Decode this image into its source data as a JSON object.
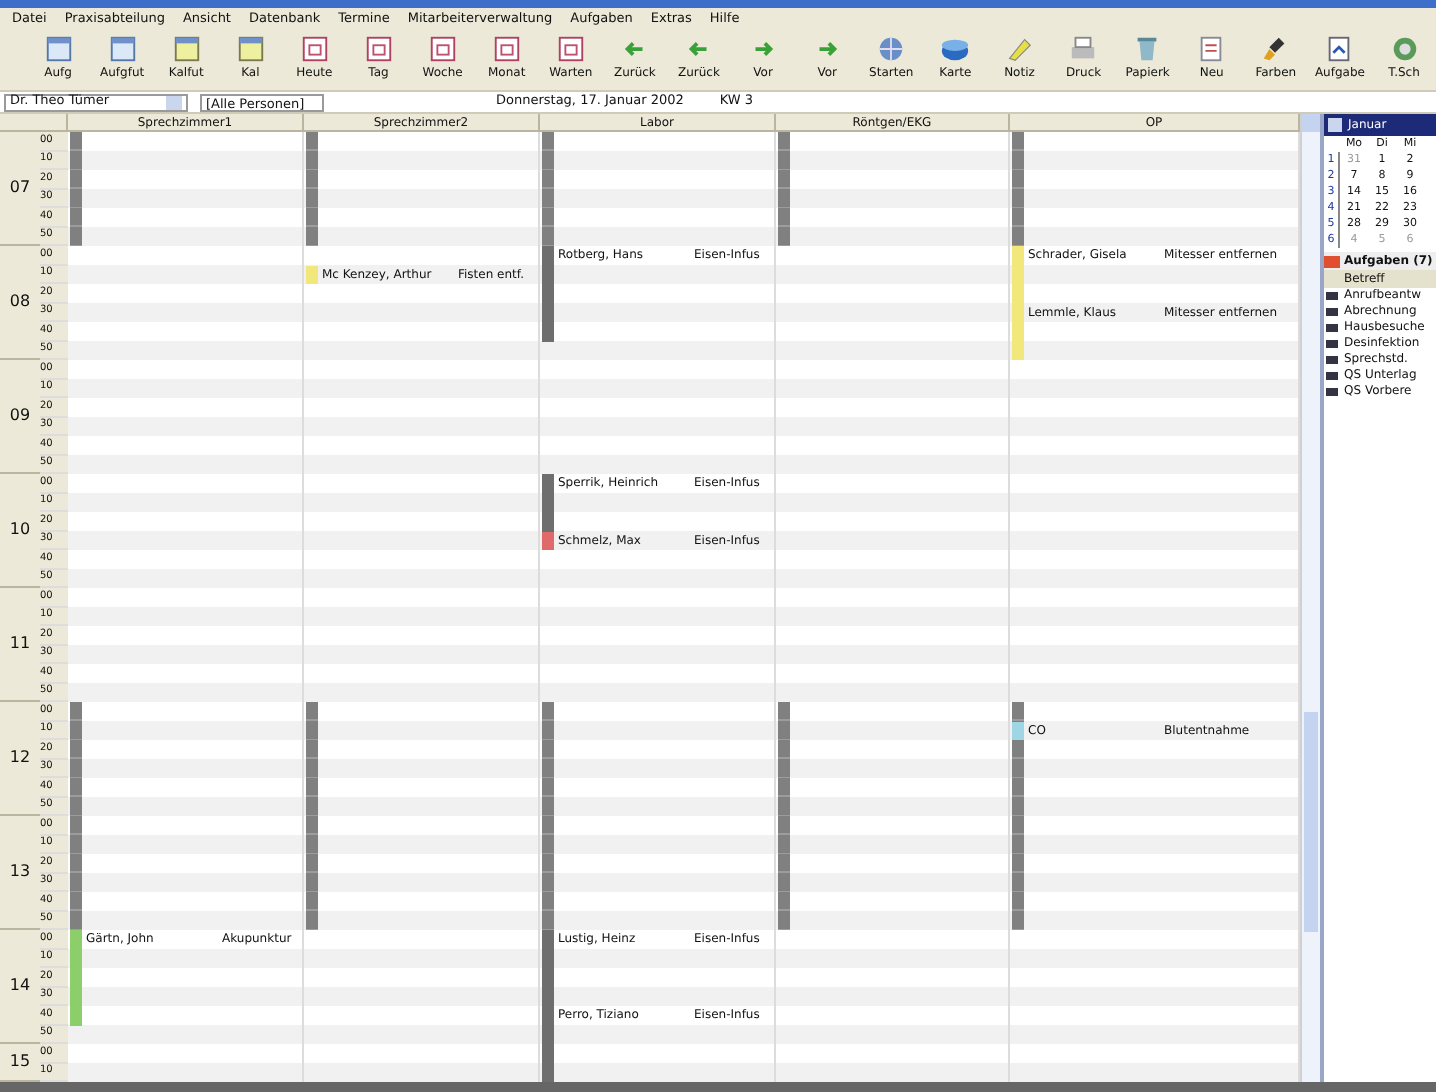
{
  "menu": [
    "Datei",
    "Praxisabteilung",
    "Ansicht",
    "Datenbank",
    "Termine",
    "Mitarbeiterverwaltung",
    "Aufgaben",
    "Extras",
    "Hilfe"
  ],
  "toolbar": [
    {
      "label": "Aufg",
      "kind": "window"
    },
    {
      "label": "Aufgfut",
      "kind": "window"
    },
    {
      "label": "Kalfut",
      "kind": "window-yellow"
    },
    {
      "label": "Kal",
      "kind": "window-yellow"
    },
    {
      "label": "Heute",
      "kind": "calendar"
    },
    {
      "label": "Tag",
      "kind": "calendar"
    },
    {
      "label": "Woche",
      "kind": "calendar"
    },
    {
      "label": "Monat",
      "kind": "calendar"
    },
    {
      "label": "Warten",
      "kind": "calendar"
    },
    {
      "label": "Zurück",
      "kind": "arrow-left"
    },
    {
      "label": "Zurück",
      "kind": "arrow-left"
    },
    {
      "label": "Vor",
      "kind": "arrow-right"
    },
    {
      "label": "Vor",
      "kind": "arrow-right"
    },
    {
      "label": "Starten",
      "kind": "globe"
    },
    {
      "label": "Karte",
      "kind": "card"
    },
    {
      "label": "Notiz",
      "kind": "note"
    },
    {
      "label": "Druck",
      "kind": "printer"
    },
    {
      "label": "Papierk",
      "kind": "bin"
    },
    {
      "label": "Neu",
      "kind": "new"
    },
    {
      "label": "Farben",
      "kind": "brush"
    },
    {
      "label": "Aufgabe",
      "kind": "task"
    },
    {
      "label": "T.Sch",
      "kind": "phone"
    }
  ],
  "filter": {
    "doctor": "Dr. Theo Tümer",
    "persons": "[Alle Personen]",
    "date": "Donnerstag, 17. Januar 2002",
    "week": "KW 3"
  },
  "hours": [
    {
      "hour": "07",
      "slots": [
        "00",
        "10",
        "20",
        "30",
        "40",
        "50"
      ]
    },
    {
      "hour": "08",
      "slots": [
        "00",
        "10",
        "20",
        "30",
        "40",
        "50"
      ]
    },
    {
      "hour": "09",
      "slots": [
        "00",
        "10",
        "20",
        "30",
        "40",
        "50"
      ]
    },
    {
      "hour": "10",
      "slots": [
        "00",
        "10",
        "20",
        "30",
        "40",
        "50"
      ]
    },
    {
      "hour": "11",
      "slots": [
        "00",
        "10",
        "20",
        "30",
        "40",
        "50"
      ]
    },
    {
      "hour": "12",
      "slots": [
        "00",
        "10",
        "20",
        "30",
        "40",
        "50"
      ]
    },
    {
      "hour": "13",
      "slots": [
        "00",
        "10",
        "20",
        "30",
        "40",
        "50"
      ]
    },
    {
      "hour": "14",
      "slots": [
        "00",
        "10",
        "20",
        "30",
        "40",
        "50"
      ]
    },
    {
      "hour": "15",
      "slots": [
        "00",
        "10"
      ]
    }
  ],
  "rooms": [
    {
      "header": "Sprechzimmer1",
      "cells": [
        {
          "kind": "blocked"
        },
        {
          "kind": "blocked"
        },
        {
          "kind": "blocked"
        },
        {
          "kind": "blocked"
        },
        {
          "kind": "blocked"
        },
        {
          "kind": "blocked"
        },
        {
          "kind": "free"
        },
        {
          "kind": "free"
        },
        {
          "kind": "free"
        },
        {
          "kind": "free"
        },
        {
          "kind": "free"
        },
        {
          "kind": "free"
        },
        {
          "kind": "free"
        },
        {
          "kind": "free"
        },
        {
          "kind": "free"
        },
        {
          "kind": "free"
        },
        {
          "kind": "free"
        },
        {
          "kind": "free"
        },
        {
          "kind": "free"
        },
        {
          "kind": "free"
        },
        {
          "kind": "free"
        },
        {
          "kind": "free"
        },
        {
          "kind": "free"
        },
        {
          "kind": "free"
        },
        {
          "kind": "free"
        },
        {
          "kind": "free"
        },
        {
          "kind": "free"
        },
        {
          "kind": "free"
        },
        {
          "kind": "free"
        },
        {
          "kind": "free"
        },
        {
          "kind": "blocked"
        },
        {
          "kind": "blocked"
        },
        {
          "kind": "blocked"
        },
        {
          "kind": "blocked"
        },
        {
          "kind": "blocked"
        },
        {
          "kind": "blocked"
        },
        {
          "kind": "blocked"
        },
        {
          "kind": "blocked"
        },
        {
          "kind": "blocked"
        },
        {
          "kind": "blocked"
        },
        {
          "kind": "blocked"
        },
        {
          "kind": "blocked"
        },
        {
          "kind": "start",
          "color": "#8ccf6a",
          "patient": "Gärtn, John",
          "reason": "Akupunktur"
        },
        {
          "kind": "continued",
          "color": "#8ccf6a"
        },
        {
          "kind": "continued",
          "color": "#8ccf6a"
        },
        {
          "kind": "continued",
          "color": "#8ccf6a"
        },
        {
          "kind": "continued",
          "color": "#8ccf6a"
        },
        {
          "kind": "free"
        },
        {
          "kind": "free"
        },
        {
          "kind": "free"
        }
      ]
    },
    {
      "header": "Sprechzimmer2",
      "cells": [
        {
          "kind": "blocked"
        },
        {
          "kind": "blocked"
        },
        {
          "kind": "blocked"
        },
        {
          "kind": "blocked"
        },
        {
          "kind": "blocked"
        },
        {
          "kind": "blocked"
        },
        {
          "kind": "free"
        },
        {
          "kind": "start",
          "color": "#f2e77a",
          "patient": "Mc Kenzey, Arthur",
          "reason": "Fisten entf."
        },
        {
          "kind": "free"
        },
        {
          "kind": "free"
        },
        {
          "kind": "free"
        },
        {
          "kind": "free"
        },
        {
          "kind": "free"
        },
        {
          "kind": "free"
        },
        {
          "kind": "free"
        },
        {
          "kind": "free"
        },
        {
          "kind": "free"
        },
        {
          "kind": "free"
        },
        {
          "kind": "free"
        },
        {
          "kind": "free"
        },
        {
          "kind": "free"
        },
        {
          "kind": "free"
        },
        {
          "kind": "free"
        },
        {
          "kind": "free"
        },
        {
          "kind": "free"
        },
        {
          "kind": "free"
        },
        {
          "kind": "free"
        },
        {
          "kind": "free"
        },
        {
          "kind": "free"
        },
        {
          "kind": "free"
        },
        {
          "kind": "blocked"
        },
        {
          "kind": "blocked"
        },
        {
          "kind": "blocked"
        },
        {
          "kind": "blocked"
        },
        {
          "kind": "blocked"
        },
        {
          "kind": "blocked"
        },
        {
          "kind": "blocked"
        },
        {
          "kind": "blocked"
        },
        {
          "kind": "blocked"
        },
        {
          "kind": "blocked"
        },
        {
          "kind": "blocked"
        },
        {
          "kind": "blocked"
        },
        {
          "kind": "free"
        },
        {
          "kind": "free"
        },
        {
          "kind": "free"
        },
        {
          "kind": "free"
        },
        {
          "kind": "free"
        },
        {
          "kind": "free"
        },
        {
          "kind": "free"
        },
        {
          "kind": "free"
        }
      ]
    },
    {
      "header": "Labor",
      "cells": [
        {
          "kind": "blocked"
        },
        {
          "kind": "blocked"
        },
        {
          "kind": "blocked"
        },
        {
          "kind": "blocked"
        },
        {
          "kind": "blocked"
        },
        {
          "kind": "blocked"
        },
        {
          "kind": "start",
          "color": "#6e6e6e",
          "patient": "Rotberg, Hans",
          "reason": "Eisen-Infus"
        },
        {
          "kind": "continued",
          "color": "#6e6e6e"
        },
        {
          "kind": "continued",
          "color": "#6e6e6e"
        },
        {
          "kind": "continued",
          "color": "#6e6e6e"
        },
        {
          "kind": "continued",
          "color": "#6e6e6e"
        },
        {
          "kind": "free"
        },
        {
          "kind": "free"
        },
        {
          "kind": "free"
        },
        {
          "kind": "free"
        },
        {
          "kind": "free"
        },
        {
          "kind": "free"
        },
        {
          "kind": "free"
        },
        {
          "kind": "start",
          "color": "#6e6e6e",
          "patient": "Sperrik, Heinrich",
          "reason": "Eisen-Infus"
        },
        {
          "kind": "continued",
          "color": "#6e6e6e"
        },
        {
          "kind": "continued",
          "color": "#6e6e6e"
        },
        {
          "kind": "start",
          "color": "#e06a6a",
          "patient": "Schmelz, Max",
          "reason": "Eisen-Infus"
        },
        {
          "kind": "free"
        },
        {
          "kind": "free"
        },
        {
          "kind": "free"
        },
        {
          "kind": "free"
        },
        {
          "kind": "free"
        },
        {
          "kind": "free"
        },
        {
          "kind": "free"
        },
        {
          "kind": "free"
        },
        {
          "kind": "blocked"
        },
        {
          "kind": "blocked"
        },
        {
          "kind": "blocked"
        },
        {
          "kind": "blocked"
        },
        {
          "kind": "blocked"
        },
        {
          "kind": "blocked"
        },
        {
          "kind": "blocked"
        },
        {
          "kind": "blocked"
        },
        {
          "kind": "blocked"
        },
        {
          "kind": "blocked"
        },
        {
          "kind": "blocked"
        },
        {
          "kind": "blocked"
        },
        {
          "kind": "start",
          "color": "#6e6e6e",
          "patient": "Lustig, Heinz",
          "reason": "Eisen-Infus"
        },
        {
          "kind": "continued",
          "color": "#6e6e6e"
        },
        {
          "kind": "continued",
          "color": "#6e6e6e"
        },
        {
          "kind": "continued",
          "color": "#6e6e6e"
        },
        {
          "kind": "start",
          "color": "#6e6e6e",
          "patient": "Perro, Tiziano",
          "reason": "Eisen-Infus"
        },
        {
          "kind": "continued",
          "color": "#6e6e6e"
        },
        {
          "kind": "continued",
          "color": "#6e6e6e"
        },
        {
          "kind": "continued",
          "color": "#6e6e6e"
        }
      ]
    },
    {
      "header": "Röntgen/EKG",
      "cells": [
        {
          "kind": "blocked"
        },
        {
          "kind": "blocked"
        },
        {
          "kind": "blocked"
        },
        {
          "kind": "blocked"
        },
        {
          "kind": "blocked"
        },
        {
          "kind": "blocked"
        },
        {
          "kind": "free"
        },
        {
          "kind": "free"
        },
        {
          "kind": "free"
        },
        {
          "kind": "free"
        },
        {
          "kind": "free"
        },
        {
          "kind": "free"
        },
        {
          "kind": "free"
        },
        {
          "kind": "free"
        },
        {
          "kind": "free"
        },
        {
          "kind": "free"
        },
        {
          "kind": "free"
        },
        {
          "kind": "free"
        },
        {
          "kind": "free"
        },
        {
          "kind": "free"
        },
        {
          "kind": "free"
        },
        {
          "kind": "free"
        },
        {
          "kind": "free"
        },
        {
          "kind": "free"
        },
        {
          "kind": "free"
        },
        {
          "kind": "free"
        },
        {
          "kind": "free"
        },
        {
          "kind": "free"
        },
        {
          "kind": "free"
        },
        {
          "kind": "free"
        },
        {
          "kind": "blocked"
        },
        {
          "kind": "blocked"
        },
        {
          "kind": "blocked"
        },
        {
          "kind": "blocked"
        },
        {
          "kind": "blocked"
        },
        {
          "kind": "blocked"
        },
        {
          "kind": "blocked"
        },
        {
          "kind": "blocked"
        },
        {
          "kind": "blocked"
        },
        {
          "kind": "blocked"
        },
        {
          "kind": "blocked"
        },
        {
          "kind": "blocked"
        },
        {
          "kind": "free"
        },
        {
          "kind": "free"
        },
        {
          "kind": "free"
        },
        {
          "kind": "free"
        },
        {
          "kind": "free"
        },
        {
          "kind": "free"
        },
        {
          "kind": "free"
        },
        {
          "kind": "free"
        }
      ]
    },
    {
      "header": "OP",
      "cells": [
        {
          "kind": "blocked"
        },
        {
          "kind": "blocked"
        },
        {
          "kind": "blocked"
        },
        {
          "kind": "blocked"
        },
        {
          "kind": "blocked"
        },
        {
          "kind": "blocked"
        },
        {
          "kind": "start",
          "color": "#f2e77a",
          "patient": "Schrader, Gisela",
          "reason": "Mitesser entfernen"
        },
        {
          "kind": "continued",
          "color": "#f2e77a"
        },
        {
          "kind": "continued",
          "color": "#f2e77a"
        },
        {
          "kind": "start",
          "color": "#f2e77a",
          "patient": "Lemmle, Klaus",
          "reason": "Mitesser entfernen"
        },
        {
          "kind": "continued",
          "color": "#f2e77a"
        },
        {
          "kind": "continued",
          "color": "#f2e77a"
        },
        {
          "kind": "free"
        },
        {
          "kind": "free"
        },
        {
          "kind": "free"
        },
        {
          "kind": "free"
        },
        {
          "kind": "free"
        },
        {
          "kind": "free"
        },
        {
          "kind": "free"
        },
        {
          "kind": "free"
        },
        {
          "kind": "free"
        },
        {
          "kind": "free"
        },
        {
          "kind": "free"
        },
        {
          "kind": "free"
        },
        {
          "kind": "free"
        },
        {
          "kind": "free"
        },
        {
          "kind": "free"
        },
        {
          "kind": "free"
        },
        {
          "kind": "free"
        },
        {
          "kind": "free"
        },
        {
          "kind": "blocked"
        },
        {
          "kind": "start",
          "color": "#9fd6e6",
          "patient": "CO",
          "reason": "Blutentnahme"
        },
        {
          "kind": "blocked"
        },
        {
          "kind": "blocked"
        },
        {
          "kind": "blocked"
        },
        {
          "kind": "blocked"
        },
        {
          "kind": "blocked"
        },
        {
          "kind": "blocked"
        },
        {
          "kind": "blocked"
        },
        {
          "kind": "blocked"
        },
        {
          "kind": "blocked"
        },
        {
          "kind": "blocked"
        },
        {
          "kind": "free"
        },
        {
          "kind": "free"
        },
        {
          "kind": "free"
        },
        {
          "kind": "free"
        },
        {
          "kind": "free"
        },
        {
          "kind": "free"
        },
        {
          "kind": "free"
        },
        {
          "kind": "free"
        }
      ]
    }
  ],
  "calendar": {
    "month": "Januar",
    "weekdays": [
      "Mo",
      "Di",
      "Mi"
    ],
    "weeks": [
      {
        "number": "1",
        "days": [
          {
            "day": "31",
            "other_month": true
          },
          {
            "day": "1",
            "other_month": false
          },
          {
            "day": "2",
            "other_month": false
          }
        ]
      },
      {
        "number": "2",
        "days": [
          {
            "day": "7",
            "other_month": false
          },
          {
            "day": "8",
            "other_month": false
          },
          {
            "day": "9",
            "other_month": false
          }
        ]
      },
      {
        "number": "3",
        "days": [
          {
            "day": "14",
            "other_month": false
          },
          {
            "day": "15",
            "other_month": false
          },
          {
            "day": "16",
            "other_month": false
          }
        ]
      },
      {
        "number": "4",
        "days": [
          {
            "day": "21",
            "other_month": false
          },
          {
            "day": "22",
            "other_month": false
          },
          {
            "day": "23",
            "other_month": false
          }
        ]
      },
      {
        "number": "5",
        "days": [
          {
            "day": "28",
            "other_month": false
          },
          {
            "day": "29",
            "other_month": false
          },
          {
            "day": "30",
            "other_month": false
          }
        ]
      },
      {
        "number": "6",
        "days": [
          {
            "day": "4",
            "other_month": true
          },
          {
            "day": "5",
            "other_month": true
          },
          {
            "day": "6",
            "other_month": true
          }
        ]
      }
    ]
  },
  "tasks": {
    "title": "Aufgaben (7)",
    "column": "Betreff",
    "items": [
      "Anrufbeantw",
      "Abrechnung",
      "Hausbesuche",
      "Desinfektion",
      "Sprechstd.",
      "QS Unterlag",
      "QS Vorbere"
    ]
  }
}
